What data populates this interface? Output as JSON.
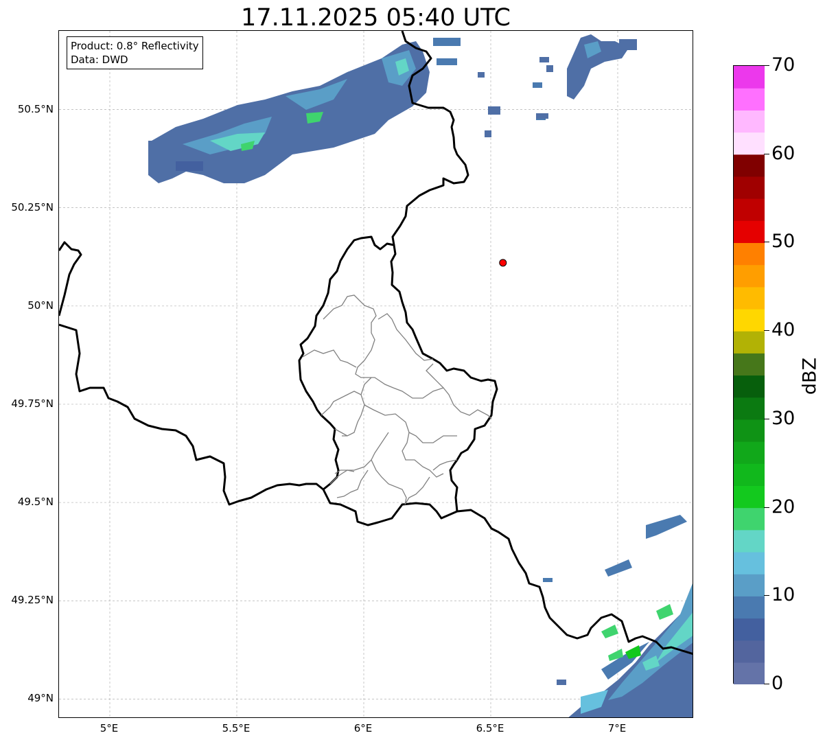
{
  "title": "17.11.2025 05:40 UTC",
  "info": {
    "product": "Product: 0.8° Reflectivity",
    "source": "Data: DWD"
  },
  "map": {
    "lon_range": [
      4.8,
      7.3
    ],
    "lat_range": [
      48.95,
      50.7
    ],
    "lon_ticks": [
      {
        "value": 5.0,
        "label": "5°E"
      },
      {
        "value": 5.5,
        "label": "5.5°E"
      },
      {
        "value": 6.0,
        "label": "6°E"
      },
      {
        "value": 6.5,
        "label": "6.5°E"
      },
      {
        "value": 7.0,
        "label": "7°E"
      }
    ],
    "lat_ticks": [
      {
        "value": 49.0,
        "label": "49°N"
      },
      {
        "value": 49.25,
        "label": "49.25°N"
      },
      {
        "value": 49.5,
        "label": "49.5°N"
      },
      {
        "value": 49.75,
        "label": "49.75°N"
      },
      {
        "value": 50.0,
        "label": "50°N"
      },
      {
        "value": 50.25,
        "label": "50.25°N"
      },
      {
        "value": 50.5,
        "label": "50.5°N"
      }
    ],
    "radar_site": {
      "lon": 6.548,
      "lat": 50.11,
      "color": "#ff0000"
    },
    "precip_cells": [
      {
        "lon": 5.2,
        "lat": 50.34,
        "dbz": 6
      },
      {
        "lon": 5.32,
        "lat": 50.42,
        "dbz": 10
      },
      {
        "lon": 5.45,
        "lat": 50.4,
        "dbz": 15
      },
      {
        "lon": 5.6,
        "lat": 50.5,
        "dbz": 8
      },
      {
        "lon": 5.75,
        "lat": 50.52,
        "dbz": 12
      },
      {
        "lon": 5.92,
        "lat": 50.48,
        "dbz": 16
      },
      {
        "lon": 6.05,
        "lat": 50.55,
        "dbz": 12
      },
      {
        "lon": 6.15,
        "lat": 50.6,
        "dbz": 14
      },
      {
        "lon": 6.25,
        "lat": 50.64,
        "dbz": 8
      },
      {
        "lon": 6.45,
        "lat": 50.67,
        "dbz": 6
      },
      {
        "lon": 6.8,
        "lat": 50.6,
        "dbz": 7
      },
      {
        "lon": 6.95,
        "lat": 50.66,
        "dbz": 9
      },
      {
        "lon": 7.05,
        "lat": 49.42,
        "dbz": 8
      },
      {
        "lon": 7.2,
        "lat": 49.45,
        "dbz": 10
      },
      {
        "lon": 6.98,
        "lat": 49.32,
        "dbz": 8
      },
      {
        "lon": 7.1,
        "lat": 49.28,
        "dbz": 14
      },
      {
        "lon": 7.22,
        "lat": 49.25,
        "dbz": 18
      },
      {
        "lon": 7.0,
        "lat": 49.16,
        "dbz": 22
      },
      {
        "lon": 7.12,
        "lat": 49.16,
        "dbz": 16
      },
      {
        "lon": 7.25,
        "lat": 49.17,
        "dbz": 20
      },
      {
        "lon": 6.88,
        "lat": 49.08,
        "dbz": 12
      },
      {
        "lon": 7.05,
        "lat": 49.07,
        "dbz": 18
      },
      {
        "lon": 6.95,
        "lat": 49.0,
        "dbz": 14
      },
      {
        "lon": 7.18,
        "lat": 49.05,
        "dbz": 10
      }
    ]
  },
  "colorbar": {
    "label": "dBZ",
    "vmin": 0,
    "vmax": 70,
    "ticks": [
      "0",
      "10",
      "20",
      "30",
      "40",
      "50",
      "60",
      "70"
    ],
    "colors": [
      "#6473a8",
      "#53659e",
      "#43609f",
      "#4a7ab0",
      "#5a9ec7",
      "#66c0de",
      "#63d6c6",
      "#3fd46e",
      "#13c91e",
      "#11b81c",
      "#11a81a",
      "#0f9315",
      "#0b7a11",
      "#075f0c",
      "#46771a",
      "#b2b205",
      "#ffd700",
      "#ffbb00",
      "#ff9e00",
      "#ff8000",
      "#e50000",
      "#c00000",
      "#a00000",
      "#800000",
      "#ffe0ff",
      "#ffb8ff",
      "#ff70ff",
      "#ec38ec"
    ]
  }
}
